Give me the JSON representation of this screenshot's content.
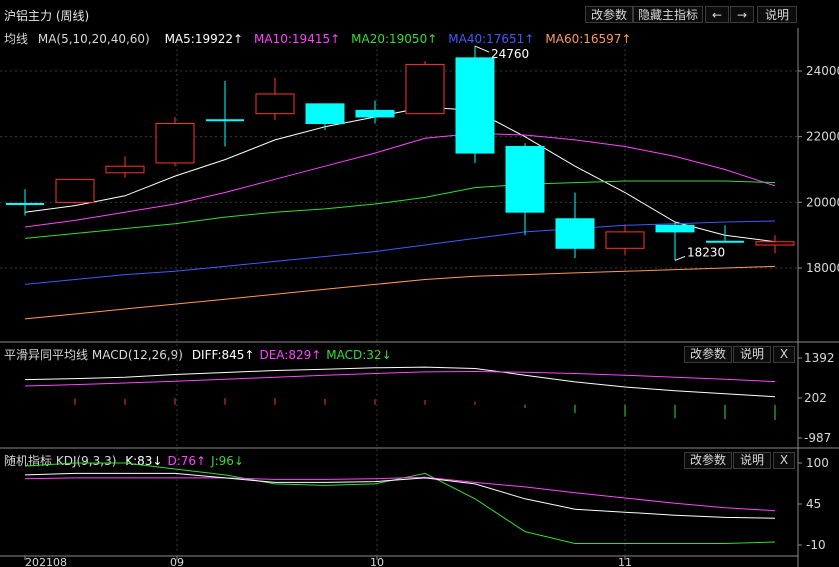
{
  "window": {
    "title": "沪铝主力 (周线)",
    "buttons": [
      "改参数",
      "隐藏主指标",
      "←",
      "→",
      "说明"
    ]
  },
  "main_panel": {
    "ma_label": "均线",
    "ma_params": "MA(5,10,20,40,60)",
    "ma_items": [
      {
        "text": "MA5:19922↑",
        "color": "#ffffff"
      },
      {
        "text": "MA10:19415↑",
        "color": "#ff44ff"
      },
      {
        "text": "MA20:19050↑",
        "color": "#33dd33"
      },
      {
        "text": "MA40:17651↑",
        "color": "#3f5bff"
      },
      {
        "text": "MA60:16597↑",
        "color": "#ff9955"
      }
    ],
    "y_ticks": [
      "24000",
      "22000",
      "20000",
      "18000"
    ],
    "annotations": {
      "high": "24760",
      "low": "18230"
    }
  },
  "macd_panel": {
    "label": "平滑异同平均线",
    "params": "MACD(12,26,9)",
    "items": [
      {
        "text": "DIFF:845↑",
        "color": "#ffffff"
      },
      {
        "text": "DEA:829↑",
        "color": "#ff44ff"
      },
      {
        "text": "MACD:32↓",
        "color": "#33dd33"
      }
    ],
    "buttons": [
      "改参数",
      "说明",
      "X"
    ],
    "y_ticks": [
      "1392",
      "202",
      "-987"
    ]
  },
  "kdj_panel": {
    "label": "随机指标",
    "params": "KDJ(9,3,3)",
    "items": [
      {
        "text": "K:83↓",
        "color": "#ffffff"
      },
      {
        "text": "D:76↑",
        "color": "#ff44ff"
      },
      {
        "text": "J:96↓",
        "color": "#33dd33"
      }
    ],
    "buttons": [
      "改参数",
      "说明",
      "X"
    ],
    "y_ticks": [
      "100",
      "45",
      "-10"
    ]
  },
  "x_axis": {
    "labels": [
      "202108",
      "09",
      "10",
      "11"
    ]
  },
  "chart_data": {
    "type": "candlestick",
    "ylim": [
      16000,
      25000
    ],
    "candles": [
      {
        "o": 19950,
        "c": 19950,
        "h": 20400,
        "l": 19600,
        "dir": "flat"
      },
      {
        "o": 20000,
        "c": 20700,
        "h": 20700,
        "l": 19950,
        "dir": "up"
      },
      {
        "o": 20900,
        "c": 21100,
        "h": 21400,
        "l": 20750,
        "dir": "up"
      },
      {
        "o": 21200,
        "c": 22400,
        "h": 22600,
        "l": 21100,
        "dir": "up"
      },
      {
        "o": 22500,
        "c": 22500,
        "h": 23700,
        "l": 21700,
        "dir": "flat"
      },
      {
        "o": 22700,
        "c": 23300,
        "h": 23800,
        "l": 22500,
        "dir": "up"
      },
      {
        "o": 23000,
        "c": 22400,
        "h": 23000,
        "l": 22200,
        "dir": "down"
      },
      {
        "o": 22800,
        "c": 22600,
        "h": 23100,
        "l": 22400,
        "dir": "down"
      },
      {
        "o": 22700,
        "c": 24200,
        "h": 24300,
        "l": 22700,
        "dir": "up"
      },
      {
        "o": 24400,
        "c": 21500,
        "h": 24760,
        "l": 21200,
        "dir": "down"
      },
      {
        "o": 21700,
        "c": 19700,
        "h": 21800,
        "l": 19000,
        "dir": "down"
      },
      {
        "o": 19500,
        "c": 18600,
        "h": 20300,
        "l": 18300,
        "dir": "down"
      },
      {
        "o": 18600,
        "c": 19100,
        "h": 19300,
        "l": 18400,
        "dir": "up"
      },
      {
        "o": 19300,
        "c": 19100,
        "h": 19400,
        "l": 18230,
        "dir": "down"
      },
      {
        "o": 18800,
        "c": 18800,
        "h": 19300,
        "l": 18800,
        "dir": "flat"
      },
      {
        "o": 18700,
        "c": 18800,
        "h": 19000,
        "l": 18450,
        "dir": "up"
      }
    ],
    "ma_series": [
      {
        "name": "MA5",
        "color": "#ffffff",
        "values": [
          19700,
          19900,
          20200,
          20800,
          21300,
          21900,
          22300,
          22600,
          22900,
          22800,
          22000,
          21100,
          20300,
          19400,
          19000,
          18800
        ]
      },
      {
        "name": "MA10",
        "color": "#ff44ff",
        "values": [
          19250,
          19450,
          19700,
          19950,
          20300,
          20700,
          21100,
          21500,
          21950,
          22100,
          22050,
          21900,
          21700,
          21400,
          21000,
          20500
        ]
      },
      {
        "name": "MA20",
        "color": "#33dd33",
        "values": [
          18900,
          19050,
          19200,
          19350,
          19550,
          19700,
          19800,
          19950,
          20150,
          20450,
          20550,
          20600,
          20650,
          20650,
          20650,
          20600
        ]
      },
      {
        "name": "MA40",
        "color": "#3f5bff",
        "values": [
          17500,
          17650,
          17800,
          17900,
          18050,
          18200,
          18350,
          18500,
          18700,
          18900,
          19100,
          19200,
          19300,
          19350,
          19400,
          19430
        ]
      },
      {
        "name": "MA60",
        "color": "#ff9955",
        "values": [
          16450,
          16600,
          16750,
          16900,
          17050,
          17200,
          17350,
          17500,
          17650,
          17750,
          17800,
          17850,
          17900,
          17950,
          18000,
          18050
        ]
      }
    ]
  },
  "macd_data": {
    "ylim": [
      -987,
      1392
    ],
    "diff": [
      750,
      780,
      820,
      900,
      960,
      1020,
      1060,
      1100,
      1120,
      1080,
      880,
      680,
      530,
      420,
      330,
      240
    ],
    "dea": [
      560,
      600,
      650,
      700,
      760,
      820,
      880,
      930,
      980,
      990,
      970,
      930,
      880,
      820,
      760,
      690
    ],
    "macd": [
      0,
      190,
      180,
      200,
      200,
      200,
      180,
      170,
      140,
      90,
      -90,
      -250,
      -350,
      -400,
      -430,
      -450
    ]
  },
  "kdj_data": {
    "ylim": [
      -10,
      100
    ],
    "k": [
      84,
      86,
      86,
      86,
      80,
      74,
      74,
      75,
      80,
      72,
      52,
      38,
      34,
      30,
      27,
      26
    ],
    "d": [
      79,
      80,
      80,
      80,
      80,
      78,
      78,
      79,
      81,
      74,
      68,
      60,
      53,
      46,
      40,
      36
    ],
    "j": [
      96,
      100,
      100,
      92,
      84,
      72,
      70,
      72,
      86,
      52,
      8,
      -8,
      -8,
      -8,
      -8,
      -6
    ]
  }
}
